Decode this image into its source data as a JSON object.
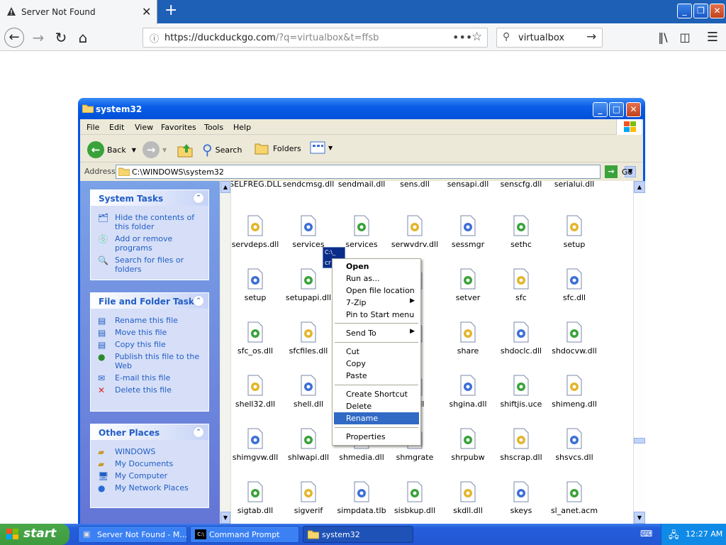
{
  "browser": {
    "tab_title": "Server Not Found",
    "url_host": "https://duckduckgo.com",
    "url_path": "/?q=virtualbox&t=ffsb",
    "search_value": "virtualbox"
  },
  "window": {
    "title": "system32",
    "menu": [
      "File",
      "Edit",
      "View",
      "Favorites",
      "Tools",
      "Help"
    ],
    "toolbar": {
      "back": "Back",
      "search": "Search",
      "folders": "Folders"
    },
    "address_label": "Address",
    "address_value": "C:\\WINDOWS\\system32",
    "go": "Go"
  },
  "system_tasks": {
    "title": "System Tasks",
    "items": [
      "Hide the contents of this folder",
      "Add or remove programs",
      "Search for files or folders"
    ]
  },
  "file_tasks": {
    "title": "File and Folder Tasks",
    "items": [
      "Rename this file",
      "Move this file",
      "Copy this file",
      "Publish this file to the Web",
      "E-mail this file",
      "Delete this file"
    ]
  },
  "other_places": {
    "title": "Other Places",
    "items": [
      "WINDOWS",
      "My Documents",
      "My Computer",
      "My Network Places"
    ]
  },
  "files": [
    [
      "SELFREG.DLL",
      "sendcmsg.dll",
      "sendmail.dll",
      "sens.dll",
      "sensapi.dll",
      "senscfg.dll",
      "serialui.dll"
    ],
    [
      "servdeps.dll",
      "services",
      "services",
      "serwvdrv.dll",
      "sessmgr",
      "sethc",
      "setup"
    ],
    [
      "setup",
      "setupapi.dll",
      "",
      "on",
      "setver",
      "sfc",
      "sfc.dll"
    ],
    [
      "sfc_os.dll",
      "sfcfiles.dll",
      "",
      "ow",
      "share",
      "shdoclc.dll",
      "shdocvw.dll"
    ],
    [
      "shell32.dll",
      "shell.dll",
      "",
      "er.dll",
      "shgina.dll",
      "shiftjis.uce",
      "shimeng.dll"
    ],
    [
      "shimgvw.dll",
      "shlwapi.dll",
      "shmedia.dll",
      "shmgrate",
      "shrpubw",
      "shscrap.dll",
      "shsvcs.dll"
    ],
    [
      "sigtab.dll",
      "sigverif",
      "simpdata.tlb",
      "sisbkup.dll",
      "skdll.dll",
      "skeys",
      "sl_anet.acm"
    ]
  ],
  "drag_label": "cr",
  "context_menu": [
    "Open",
    "Run as...",
    "Open file location",
    "7-Zip",
    "Pin to Start menu",
    "Send To",
    "Cut",
    "Copy",
    "Paste",
    "Create Shortcut",
    "Delete",
    "Rename",
    "Properties"
  ],
  "taskbar": {
    "start": "start",
    "items": [
      "Server Not Found - M...",
      "Command Prompt",
      "system32"
    ],
    "clock": "12:27 AM"
  }
}
